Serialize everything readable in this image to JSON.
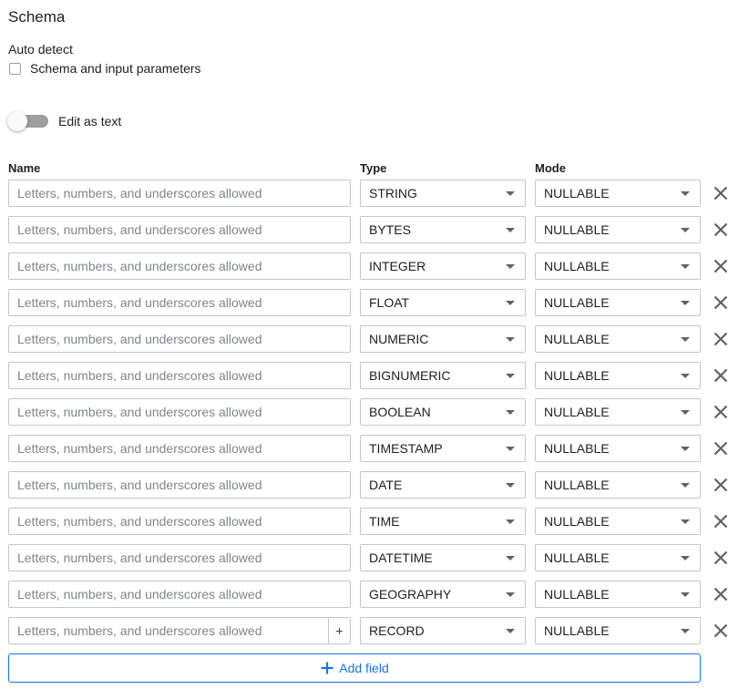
{
  "schema": {
    "title": "Schema",
    "auto_detect_label": "Auto detect",
    "checkbox_label": "Schema and input parameters",
    "checkbox_checked": false,
    "toggle_label": "Edit as text",
    "toggle_on": false
  },
  "columns": {
    "name": "Name",
    "type": "Type",
    "mode": "Mode"
  },
  "name_placeholder": "Letters, numbers, and underscores allowed",
  "fields": [
    {
      "name": "",
      "type": "STRING",
      "mode": "NULLABLE"
    },
    {
      "name": "",
      "type": "BYTES",
      "mode": "NULLABLE"
    },
    {
      "name": "",
      "type": "INTEGER",
      "mode": "NULLABLE"
    },
    {
      "name": "",
      "type": "FLOAT",
      "mode": "NULLABLE"
    },
    {
      "name": "",
      "type": "NUMERIC",
      "mode": "NULLABLE"
    },
    {
      "name": "",
      "type": "BIGNUMERIC",
      "mode": "NULLABLE"
    },
    {
      "name": "",
      "type": "BOOLEAN",
      "mode": "NULLABLE"
    },
    {
      "name": "",
      "type": "TIMESTAMP",
      "mode": "NULLABLE"
    },
    {
      "name": "",
      "type": "DATE",
      "mode": "NULLABLE"
    },
    {
      "name": "",
      "type": "TIME",
      "mode": "NULLABLE"
    },
    {
      "name": "",
      "type": "DATETIME",
      "mode": "NULLABLE"
    },
    {
      "name": "",
      "type": "GEOGRAPHY",
      "mode": "NULLABLE"
    },
    {
      "name": "",
      "type": "RECORD",
      "mode": "NULLABLE",
      "has_nested_add": true
    }
  ],
  "nested_add_label": "+",
  "add_field_label": "Add field",
  "icons": {
    "delete": "close-icon",
    "dropdown": "caret-down-icon",
    "add": "plus-icon"
  },
  "colors": {
    "accent": "#1a73e8",
    "toggle_track": "#9e9e9e",
    "border": "#c6c6c6"
  }
}
